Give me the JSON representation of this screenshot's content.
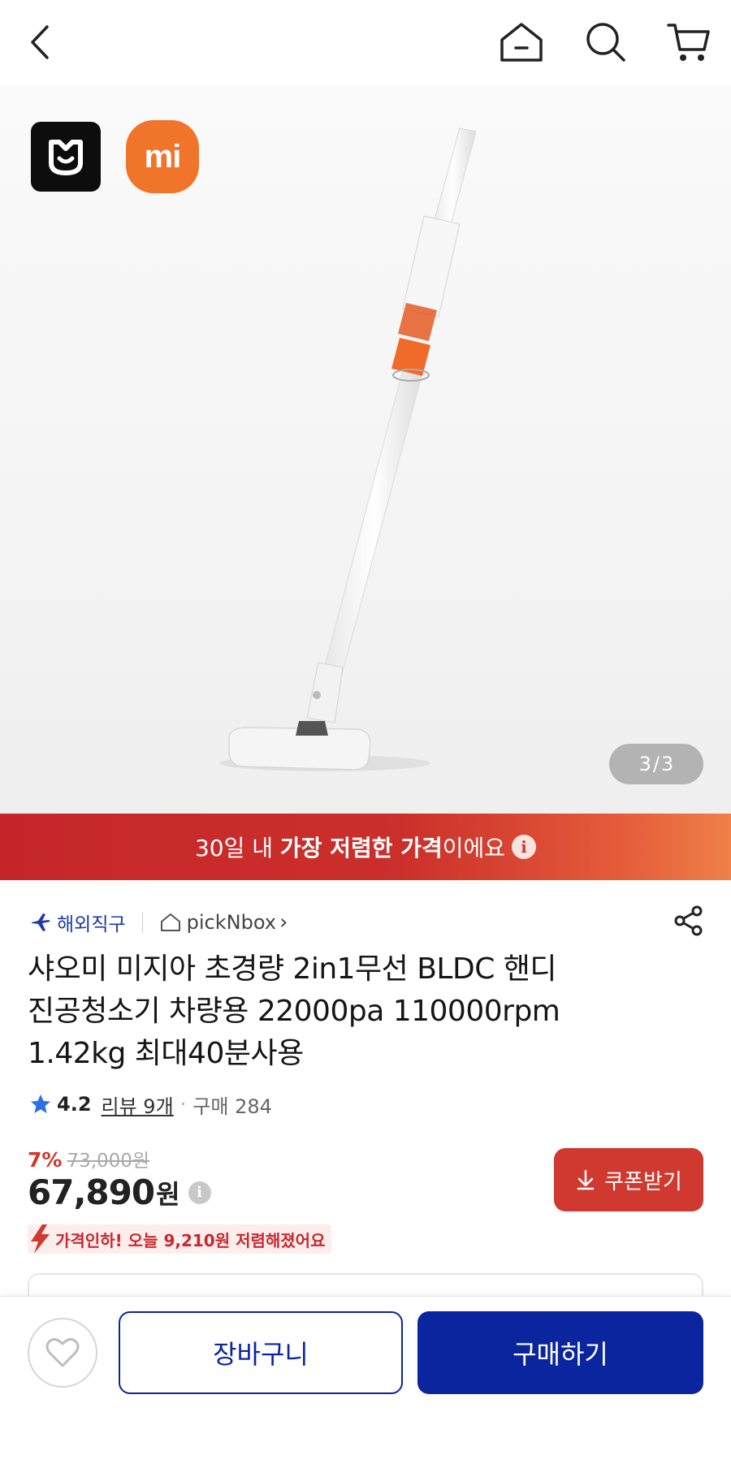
{
  "header": {
    "icons": [
      "chevron-left-icon",
      "home-icon",
      "search-icon",
      "cart-icon"
    ]
  },
  "gallery": {
    "current_page": "3",
    "separator": "/",
    "total_pages": "3",
    "brand_logos": [
      "mijia-logo",
      "mi-logo"
    ],
    "brand_mi_text": "mi",
    "colors": {
      "mijia": "#0d0d0d",
      "mi": "#f0742a"
    }
  },
  "banner": {
    "text_prefix": "30일 내 ",
    "text_bold": "가장 저렴한 가격",
    "text_suffix": "이에요",
    "info_glyph": "i",
    "colors": {
      "start": "#c6262a",
      "end": "#ee8048"
    }
  },
  "meta": {
    "overseas_label": "해외직구",
    "seller_name": "pickNbox",
    "seller_chevron": "›"
  },
  "product": {
    "title_line1": "샤오미 미지아 초경량 2in1무선 BLDC 핸디",
    "title_line2": "진공청소기 차량용 22000pa 110000rpm",
    "title_line3": "1.42kg 최대40분사용"
  },
  "rating": {
    "score": "4.2",
    "review_label": "리뷰 9개",
    "separator": "·",
    "purchase_label": "구매 284"
  },
  "pricing": {
    "discount_pct": "7%",
    "original_price": "73,000원",
    "price": "67,890",
    "currency": "원",
    "info_glyph": "i",
    "coupon_label": "쿠폰받기",
    "price_drop_text": "가격인하! 오늘 9,210원 저렴해졌어요",
    "colors": {
      "accent": "#d0392f"
    }
  },
  "bottom_bar": {
    "cart_label": "장바구니",
    "buy_label": "구매하기",
    "colors": {
      "primary": "#0b259e"
    }
  }
}
